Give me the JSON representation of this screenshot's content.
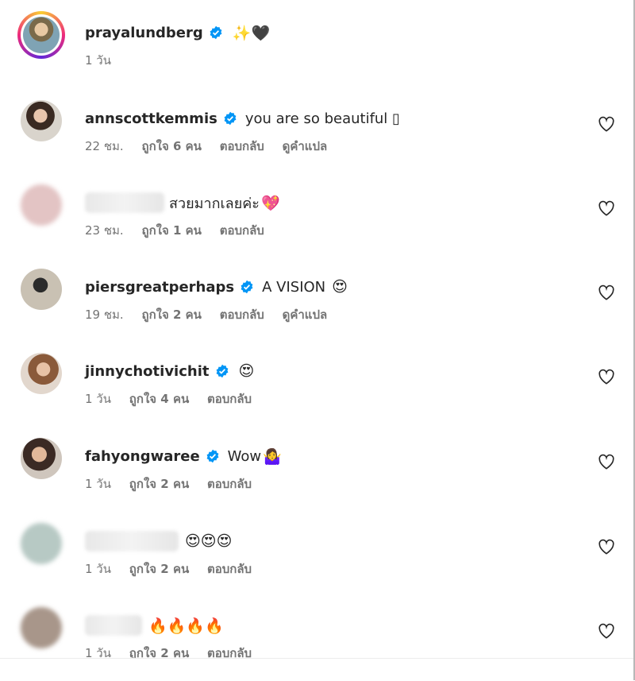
{
  "caption": {
    "username": "prayalundberg",
    "text": "",
    "emoji": "✨🖤",
    "time": "1 วัน"
  },
  "comments": [
    {
      "username": "annscottkemmis",
      "verified": true,
      "text": "you are so beautiful ▯",
      "emoji": "",
      "time": "22 ชม.",
      "likes": "ถูกใจ 6 คน",
      "reply": "ตอบกลับ",
      "translate": "ดูคำแปล"
    },
    {
      "username": "",
      "verified": false,
      "text": "สวยมากเลยค่ะ",
      "emoji": "💖",
      "time": "23 ชม.",
      "likes": "ถูกใจ 1 คน",
      "reply": "ตอบกลับ",
      "translate": ""
    },
    {
      "username": "piersgreatperhaps",
      "verified": true,
      "text": "A VISION",
      "emoji": "😍",
      "time": "19 ชม.",
      "likes": "ถูกใจ 2 คน",
      "reply": "ตอบกลับ",
      "translate": "ดูคำแปล"
    },
    {
      "username": "jinnychotivichit",
      "verified": true,
      "text": "",
      "emoji": "😍",
      "time": "1 วัน",
      "likes": "ถูกใจ 4 คน",
      "reply": "ตอบกลับ",
      "translate": ""
    },
    {
      "username": "fahyongwaree",
      "verified": true,
      "text": "Wow",
      "emoji": "🤷‍♀️",
      "time": "1 วัน",
      "likes": "ถูกใจ 2 คน",
      "reply": "ตอบกลับ",
      "translate": ""
    },
    {
      "username": "",
      "verified": false,
      "text": "",
      "emoji": "😍😍😍",
      "time": "1 วัน",
      "likes": "ถูกใจ 2 คน",
      "reply": "ตอบกลับ",
      "translate": ""
    },
    {
      "username": "",
      "verified": false,
      "text": "",
      "emoji": "🔥🔥🔥🔥",
      "time": "1 วัน",
      "likes": "ถูกใจ 2 คน",
      "reply": "ตอบกลับ",
      "translate": ""
    }
  ],
  "colors": {
    "verified": "#0095f6",
    "meta_text": "#737373",
    "text": "#262626"
  }
}
